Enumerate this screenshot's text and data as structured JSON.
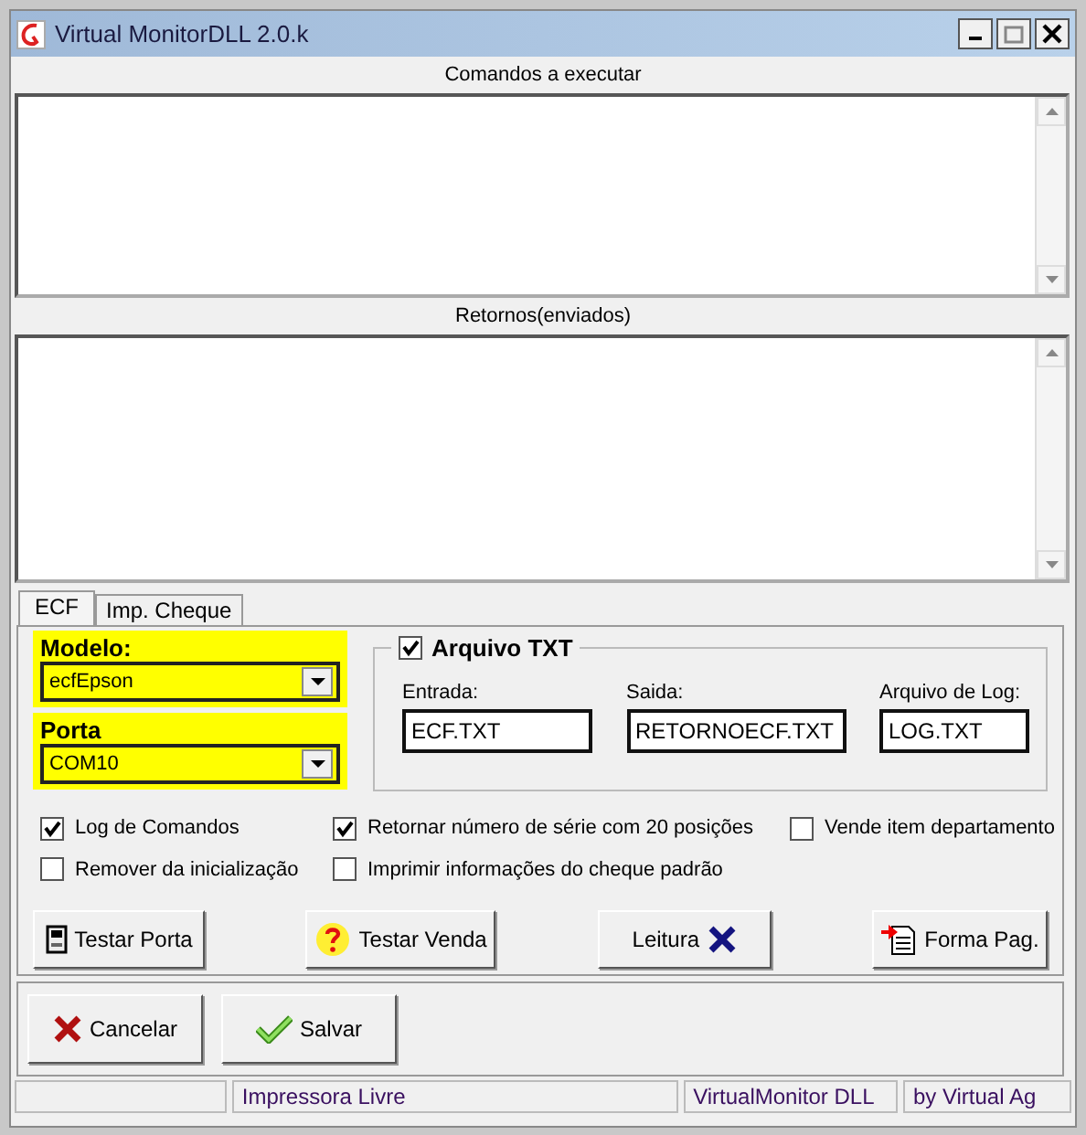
{
  "window": {
    "title": "Virtual MonitorDLL 2.0.k"
  },
  "commands": {
    "label": "Comandos a executar"
  },
  "returns": {
    "label": "Retornos(enviados)"
  },
  "tabs": [
    {
      "label": "ECF",
      "selected": true
    },
    {
      "label": "Imp. Cheque",
      "selected": false
    }
  ],
  "modelo": {
    "label": "Modelo:",
    "value": "ecfEpson"
  },
  "porta": {
    "label": "Porta",
    "value": "COM10"
  },
  "arquivo_txt": {
    "label": "Arquivo TXT",
    "checked": true,
    "fields": [
      {
        "label": "Entrada:",
        "value": "ECF.TXT"
      },
      {
        "label": "Saida:",
        "value": "RETORNOECF.TXT"
      },
      {
        "label": "Arquivo de Log:",
        "value": "LOG.TXT"
      }
    ]
  },
  "options": [
    {
      "label": "Log de Comandos",
      "checked": true
    },
    {
      "label": "Retornar número de série com 20 posições",
      "checked": true
    },
    {
      "label": "Vende item departamento",
      "checked": false
    },
    {
      "label": "Remover da inicialização",
      "checked": false
    },
    {
      "label": "Imprimir informações do cheque padrão",
      "checked": false
    }
  ],
  "actions": [
    {
      "label": "Testar Porta"
    },
    {
      "label": "Testar Venda"
    },
    {
      "label": "Leitura"
    },
    {
      "label": "Forma Pag."
    }
  ],
  "footer_buttons": [
    {
      "label": "Cancelar"
    },
    {
      "label": "Salvar"
    }
  ],
  "status_bar": [
    "Impressora Livre",
    "VirtualMonitor DLL",
    "by Virtual Ag"
  ]
}
